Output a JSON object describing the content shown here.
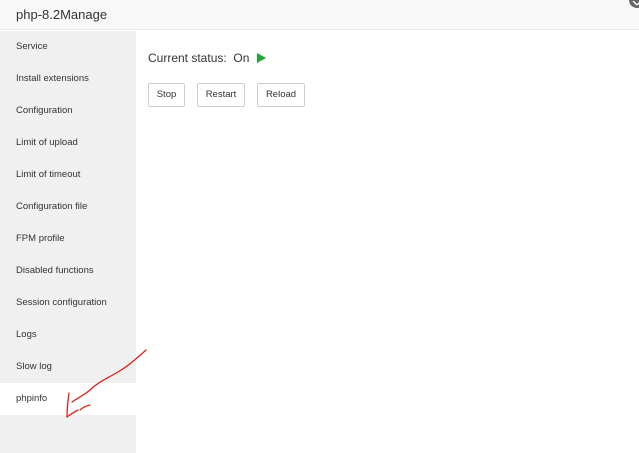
{
  "window": {
    "title": "php-8.2Manage"
  },
  "sidebar": {
    "items": [
      {
        "label": "Service",
        "active": false
      },
      {
        "label": "Install extensions",
        "active": false
      },
      {
        "label": "Configuration",
        "active": false
      },
      {
        "label": "Limit of upload",
        "active": false
      },
      {
        "label": "Limit of timeout",
        "active": false
      },
      {
        "label": "Configuration file",
        "active": false
      },
      {
        "label": "FPM profile",
        "active": false
      },
      {
        "label": "Disabled functions",
        "active": false
      },
      {
        "label": "Session configuration",
        "active": false
      },
      {
        "label": "Logs",
        "active": false
      },
      {
        "label": "Slow log",
        "active": false
      },
      {
        "label": "phpinfo",
        "active": true
      }
    ]
  },
  "main": {
    "status_label": "Current status:",
    "status_value": "On",
    "status_icon": "play-icon",
    "status_color": "#20a53a",
    "buttons": {
      "stop": "Stop",
      "restart": "Restart",
      "reload": "Reload"
    }
  },
  "annotation": {
    "color": "#e0201c",
    "icon": "hand-drawn-arrow"
  }
}
